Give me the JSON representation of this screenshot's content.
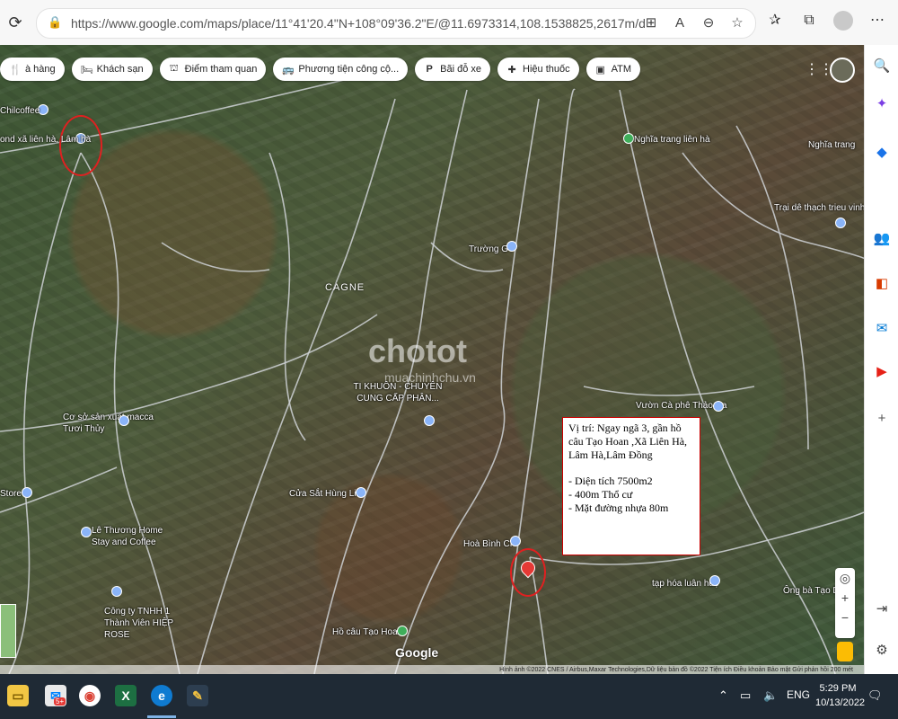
{
  "browser": {
    "url": "https://www.google.com/maps/place/11°41'20.4\"N+108°09'36.2\"E/@11.6973314,108.1538825,2617m/data=!3m1!1e3!4m5!3...",
    "url_icons": [
      "apps-icon",
      "read-aloud-icon",
      "zoom-icon",
      "favorite-add-icon"
    ],
    "toolbar_icons": [
      "favorites-icon",
      "collections-icon"
    ]
  },
  "map": {
    "chips": [
      {
        "label": "à hàng",
        "icon": "restaurant-icon"
      },
      {
        "label": "Khách sạn",
        "icon": "hotel-icon"
      },
      {
        "label": "Điểm tham quan",
        "icon": "attraction-icon"
      },
      {
        "label": "Phương tiện công cộ...",
        "icon": "transit-icon"
      },
      {
        "label": "Bãi đỗ xe",
        "icon": "parking-icon"
      },
      {
        "label": "Hiệu thuốc",
        "icon": "pharmacy-icon"
      },
      {
        "label": "ATM",
        "icon": "atm-icon"
      }
    ],
    "places": [
      {
        "label": "Chilcoffee",
        "pin": "blue"
      },
      {
        "label": "ond xã liên hà, Lâm hà",
        "pin": "blue"
      },
      {
        "label": "Nghĩa trang liên hà",
        "pin": "green"
      },
      {
        "label": "Nghĩa trang",
        "pin": "none"
      },
      {
        "label": "Trại dê thạch trieu vinh",
        "pin": "blue"
      },
      {
        "label": "Trường GT",
        "pin": "blue"
      },
      {
        "label": "TI KHUÔN - CHUYÊN CUNG CẤP PHÂN...",
        "pin": "blue"
      },
      {
        "label": "Cơ sở sản xuất macca Tươi Thủy",
        "pin": "blue"
      },
      {
        "label": "Store",
        "pin": "blue"
      },
      {
        "label": "Cửa Sắt Hùng Linh",
        "pin": "blue"
      },
      {
        "label": "Vườn Cà phê Thảo Na",
        "pin": "blue"
      },
      {
        "label": "Lê Thương Home Stay and Coffee",
        "pin": "blue"
      },
      {
        "label": "Hoà Bình CP",
        "pin": "blue"
      },
      {
        "label": "Công ty TNHH 1 Thành Viên HIỆP ROSE",
        "pin": "blue"
      },
      {
        "label": "tạp hóa luân huệ",
        "pin": "blue"
      },
      {
        "label": "Hồ câu Tạo Hoan",
        "pin": "green"
      },
      {
        "label": "Ông bà Tạo Diệu",
        "pin": "none"
      }
    ],
    "area_label": "CAGNE",
    "watermark": "chotot",
    "watermark_sub": "muachinhchu.vn",
    "callout_lines": [
      "Vị trí: Ngay ngã 3, gần hồ câu Tạo Hoan ,Xã Liên Hà, Lâm Hà,Lâm Đồng",
      "- Diện tích 7500m2",
      "- 400m Thổ cư",
      "- Mặt đường nhựa 80m"
    ],
    "google_logo": "Google",
    "attribution": "Hình ảnh ©2022 CNES / Airbus,Maxar Technologies,Dữ liệu bản đồ ©2022   Tiện ích   Điều khoản   Bảo mật   Gửi phản hồi   200 mét"
  },
  "sidebar_icons": [
    "search-icon",
    "copilot-icon",
    "shopping-icon",
    "people-icon",
    "office-icon",
    "outlook-icon",
    "youtube-icon",
    "add-icon",
    "hide-sidebar-icon",
    "settings-icon"
  ],
  "taskbar": {
    "apps": [
      "file-explorer-icon",
      "messenger-icon",
      "chrome-icon",
      "excel-icon",
      "edge-icon",
      "paint-icon"
    ],
    "badge": "5+",
    "language": "ENG",
    "time": "5:29 PM",
    "date": "10/13/2022"
  }
}
